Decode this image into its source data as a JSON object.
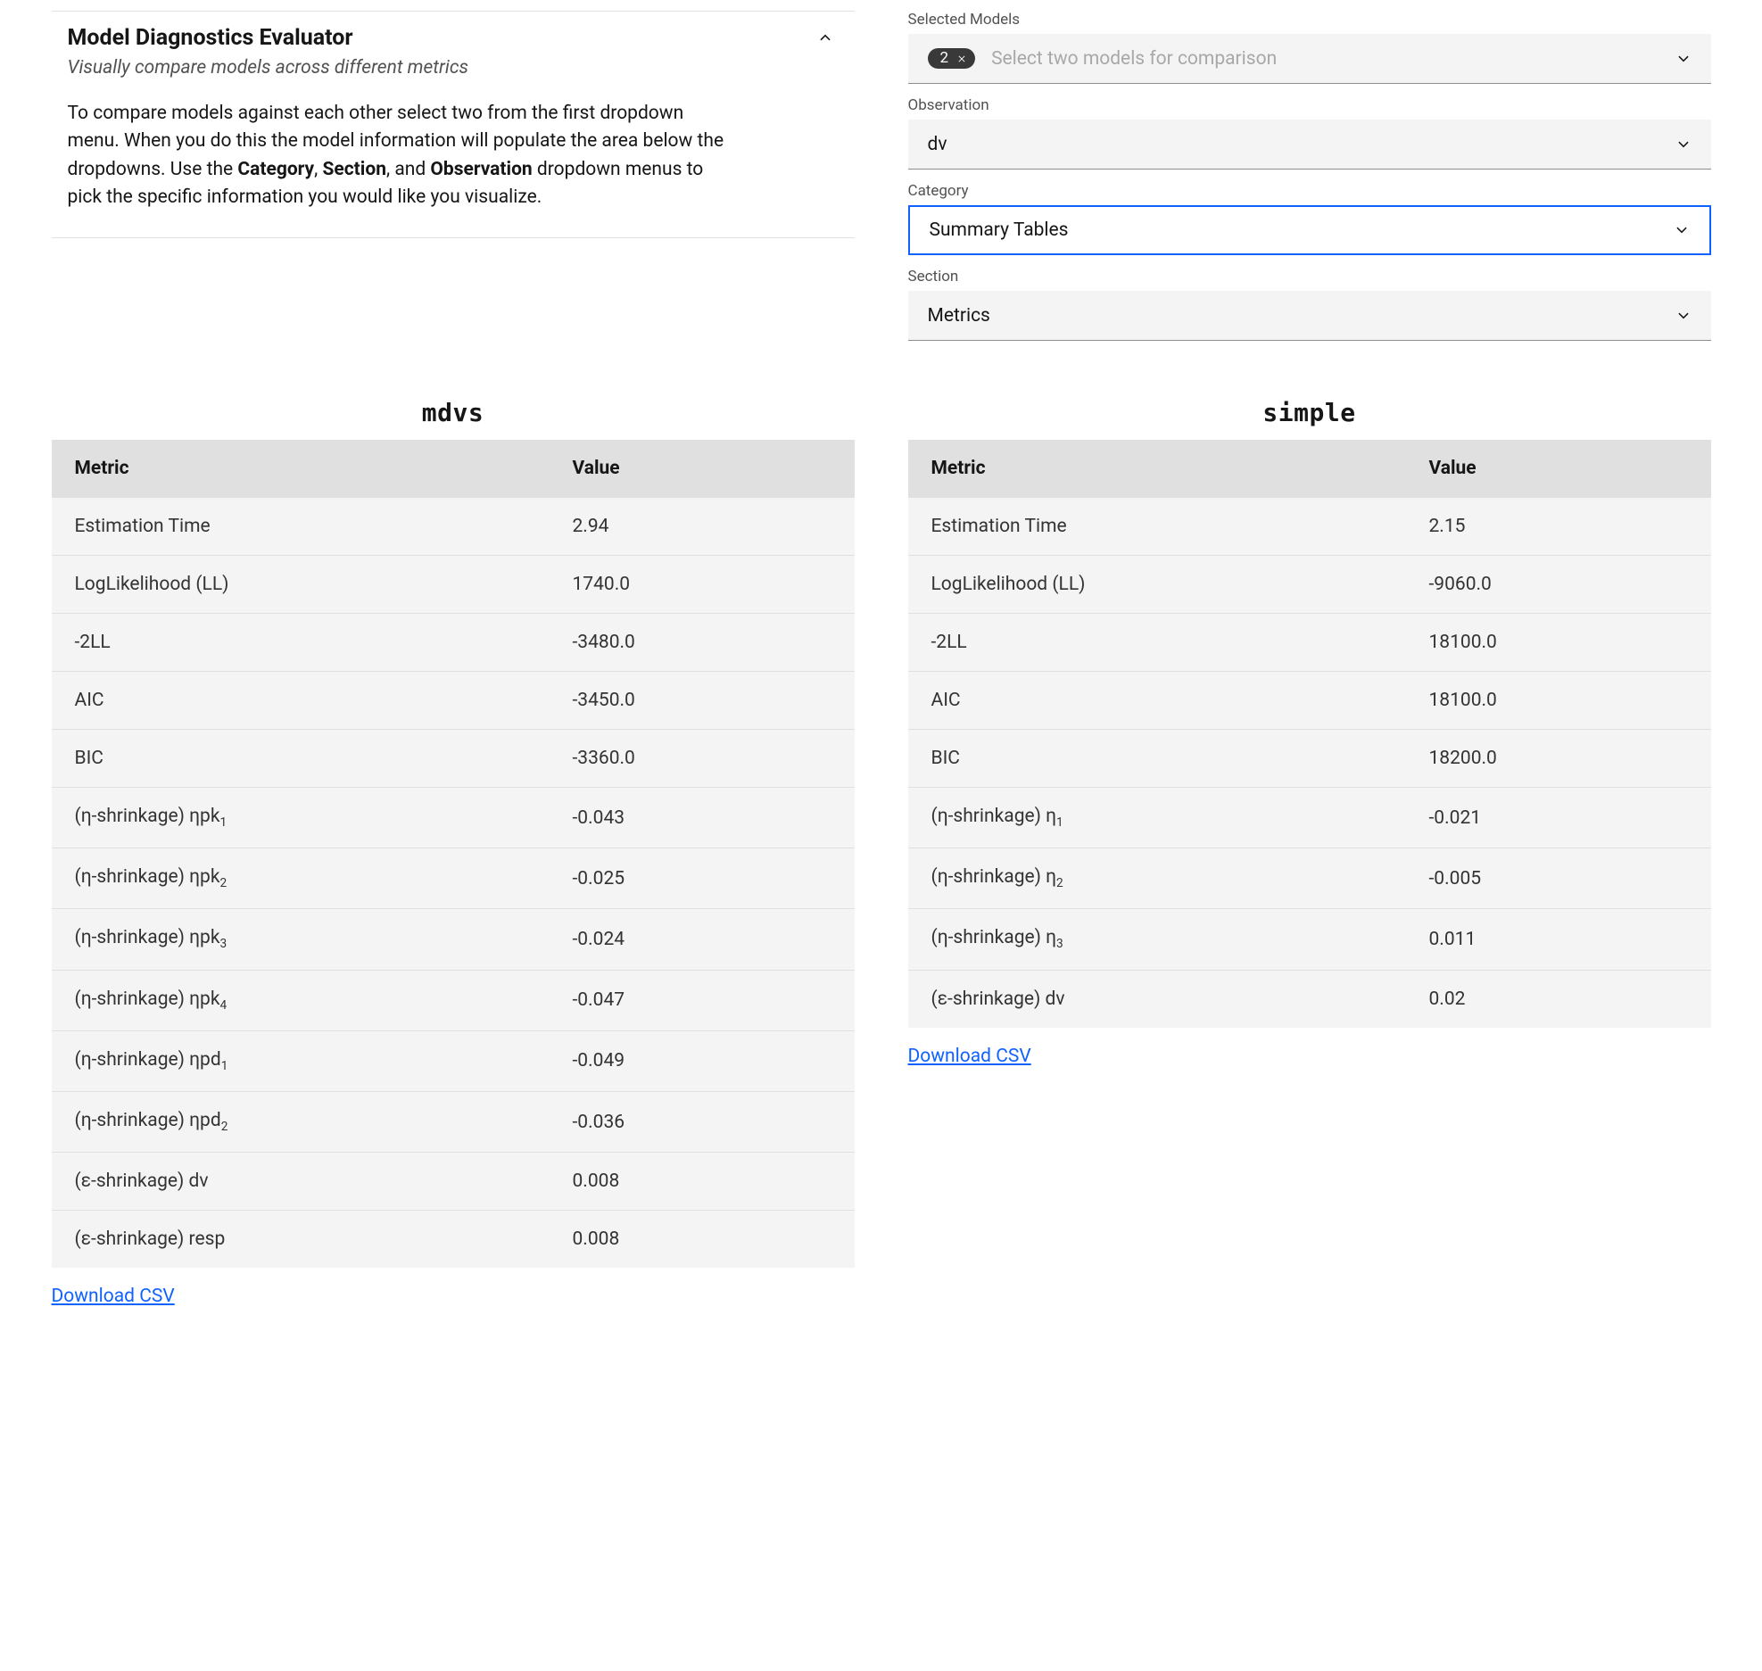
{
  "header": {
    "title": "Model Diagnostics Evaluator",
    "subtitle": "Visually compare models across different metrics",
    "description_pre": "To compare models against each other select two from the first dropdown menu. When you do this the model information will populate the area below the dropdowns. Use the ",
    "description_cat": "Category",
    "description_sep1": ", ",
    "description_sec": "Section",
    "description_sep2": ", and ",
    "description_obs": "Observation",
    "description_post": " dropdown menus to pick the specific information you would like you visualize."
  },
  "controls": {
    "selected_models": {
      "label": "Selected Models",
      "count": "2",
      "placeholder": "Select two models for comparison"
    },
    "observation": {
      "label": "Observation",
      "value": "dv"
    },
    "category": {
      "label": "Category",
      "value": "Summary Tables"
    },
    "section": {
      "label": "Section",
      "value": "Metrics"
    }
  },
  "table_headers": {
    "metric": "Metric",
    "value": "Value"
  },
  "models": {
    "a": {
      "name": "mdvs",
      "rows": [
        {
          "metric": "Estimation Time",
          "value": "2.94"
        },
        {
          "metric": "LogLikelihood (LL)",
          "value": "1740.0"
        },
        {
          "metric": "-2LL",
          "value": "-3480.0"
        },
        {
          "metric": "AIC",
          "value": "-3450.0"
        },
        {
          "metric": "BIC",
          "value": "-3360.0"
        },
        {
          "metric_html": "(η-shrinkage) ηpk<sub>1</sub>",
          "value": "-0.043"
        },
        {
          "metric_html": "(η-shrinkage) ηpk<sub>2</sub>",
          "value": "-0.025"
        },
        {
          "metric_html": "(η-shrinkage) ηpk<sub>3</sub>",
          "value": "-0.024"
        },
        {
          "metric_html": "(η-shrinkage) ηpk<sub>4</sub>",
          "value": "-0.047"
        },
        {
          "metric_html": "(η-shrinkage) ηpd<sub>1</sub>",
          "value": "-0.049"
        },
        {
          "metric_html": "(η-shrinkage) ηpd<sub>2</sub>",
          "value": "-0.036"
        },
        {
          "metric": "(ε-shrinkage) dv",
          "value": "0.008"
        },
        {
          "metric": "(ε-shrinkage) resp",
          "value": "0.008"
        }
      ],
      "download": "Download CSV"
    },
    "b": {
      "name": "simple",
      "rows": [
        {
          "metric": "Estimation Time",
          "value": "2.15"
        },
        {
          "metric": "LogLikelihood (LL)",
          "value": "-9060.0"
        },
        {
          "metric": "-2LL",
          "value": "18100.0"
        },
        {
          "metric": "AIC",
          "value": "18100.0"
        },
        {
          "metric": "BIC",
          "value": "18200.0"
        },
        {
          "metric_html": "(η-shrinkage) η<sub>1</sub>",
          "value": "-0.021"
        },
        {
          "metric_html": "(η-shrinkage) η<sub>2</sub>",
          "value": "-0.005"
        },
        {
          "metric_html": "(η-shrinkage) η<sub>3</sub>",
          "value": "0.011"
        },
        {
          "metric": "(ε-shrinkage) dv",
          "value": "0.02"
        }
      ],
      "download": "Download CSV"
    }
  }
}
